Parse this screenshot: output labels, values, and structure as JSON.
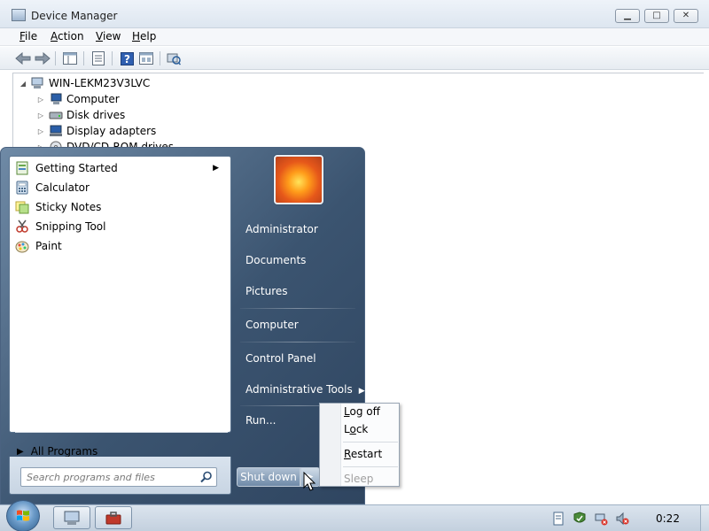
{
  "window": {
    "title": "Device Manager",
    "minimize_glyph": "▁",
    "maximize_glyph": "□",
    "close_glyph": "✕"
  },
  "menubar": {
    "file": {
      "hot": "F",
      "rest": "ile"
    },
    "action": {
      "hot": "A",
      "rest": "ction"
    },
    "view": {
      "hot": "V",
      "rest": "iew"
    },
    "help": {
      "hot": "H",
      "rest": "elp"
    }
  },
  "toolbar_icons": [
    "back-arrow-icon",
    "forward-arrow-icon",
    "show-hide-tree-icon",
    "properties-icon",
    "help-icon",
    "show-hidden-icon",
    "scan-hardware-icon"
  ],
  "tree": {
    "root": "WIN-LEKM23V3LVC",
    "children": [
      {
        "label": "Computer",
        "icon": "computer-icon"
      },
      {
        "label": "Disk drives",
        "icon": "disk-drive-icon"
      },
      {
        "label": "Display adapters",
        "icon": "display-adapter-icon"
      },
      {
        "label": "DVD/CD-ROM drives",
        "icon": "dvd-drive-icon"
      }
    ]
  },
  "start_menu": {
    "programs": [
      {
        "label": "Getting Started",
        "icon": "getting-started-icon",
        "has_submenu": true
      },
      {
        "label": "Calculator",
        "icon": "calculator-icon"
      },
      {
        "label": "Sticky Notes",
        "icon": "sticky-notes-icon"
      },
      {
        "label": "Snipping Tool",
        "icon": "snipping-tool-icon"
      },
      {
        "label": "Paint",
        "icon": "paint-icon"
      }
    ],
    "all_programs": "All Programs",
    "search_placeholder": "Search programs and files",
    "right": {
      "administrator": "Administrator",
      "documents": "Documents",
      "pictures": "Pictures",
      "computer": "Computer",
      "control_panel": "Control Panel",
      "administrative_tools": "Administrative Tools",
      "run": "Run..."
    },
    "shutdown": "Shut down"
  },
  "shutdown_menu": {
    "log_off": {
      "pre": "",
      "hot": "L",
      "rest": "og off"
    },
    "lock": {
      "pre": "L",
      "hot": "o",
      "rest": "ck"
    },
    "restart": {
      "pre": "",
      "hot": "R",
      "rest": "estart"
    },
    "sleep": "Sleep"
  },
  "taskbar": {
    "clock": "0:22"
  },
  "colors": {
    "start_menu_bg": "#3b5470",
    "accent": "#6d9cc9"
  }
}
